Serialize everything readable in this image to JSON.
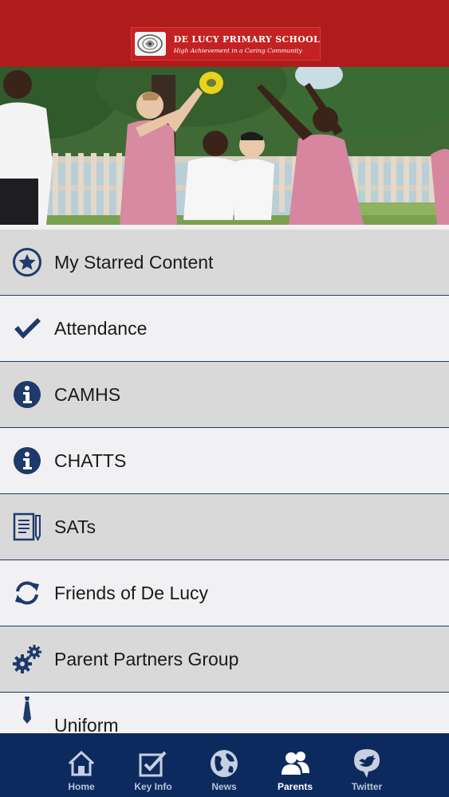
{
  "header": {
    "school_name": "DE LUCY PRIMARY SCHOOL",
    "motto": "High Achievement in a Caring Community"
  },
  "colors": {
    "header_bg": "#b01c1c",
    "menu_dark": "#d9d9d9",
    "menu_light": "#f1f1f3",
    "navy": "#0d2a5e",
    "icon_blue": "#1e3a6b"
  },
  "menu": {
    "items": [
      {
        "label": "My Starred Content",
        "icon": "star-circle-icon"
      },
      {
        "label": "Attendance",
        "icon": "checkmark-icon"
      },
      {
        "label": "CAMHS",
        "icon": "info-icon"
      },
      {
        "label": "CHATTS",
        "icon": "info-icon"
      },
      {
        "label": "SATs",
        "icon": "document-pencil-icon"
      },
      {
        "label": "Friends of De Lucy",
        "icon": "refresh-arrows-icon"
      },
      {
        "label": "Parent Partners Group",
        "icon": "gears-icon"
      },
      {
        "label": "Uniform",
        "icon": "tie-icon"
      }
    ]
  },
  "tabs": {
    "items": [
      {
        "label": "Home",
        "icon": "home-icon"
      },
      {
        "label": "Key Info",
        "icon": "checkbox-icon"
      },
      {
        "label": "News",
        "icon": "globe-icon"
      },
      {
        "label": "Parents",
        "icon": "people-icon",
        "active": true
      },
      {
        "label": "Twitter",
        "icon": "twitter-bird-icon"
      }
    ]
  }
}
